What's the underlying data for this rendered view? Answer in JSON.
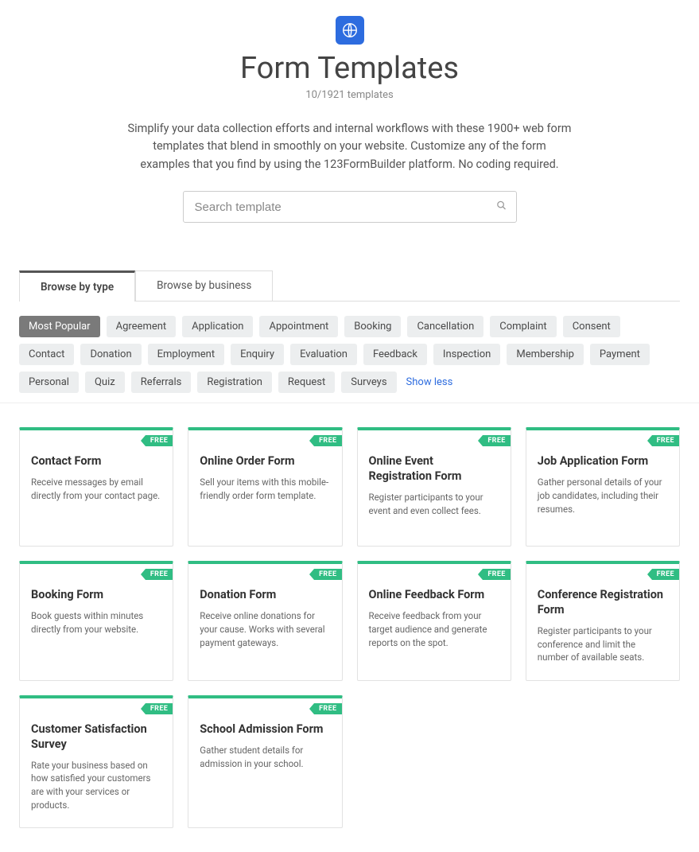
{
  "hero": {
    "title": "Form Templates",
    "count": "10/1921 templates",
    "intro": "Simplify your data collection efforts and internal workflows with these 1900+ web form templates that blend in smoothly on your website. Customize any of the form examples that you find by using the 123FormBuilder platform. No coding required."
  },
  "search": {
    "placeholder": "Search template"
  },
  "tabs": [
    {
      "label": "Browse by type"
    },
    {
      "label": "Browse by business"
    }
  ],
  "filters": [
    "Most Popular",
    "Agreement",
    "Application",
    "Appointment",
    "Booking",
    "Cancellation",
    "Complaint",
    "Consent",
    "Contact",
    "Donation",
    "Employment",
    "Enquiry",
    "Evaluation",
    "Feedback",
    "Inspection",
    "Membership",
    "Payment",
    "Personal",
    "Quiz",
    "Referrals",
    "Registration",
    "Request",
    "Surveys"
  ],
  "show_less": "Show less",
  "badge_label": "FREE",
  "cards": [
    {
      "title": "Contact Form",
      "desc": "Receive messages by email directly from your contact page."
    },
    {
      "title": "Online Order Form",
      "desc": "Sell your items with this mobile-friendly order form template."
    },
    {
      "title": "Online Event Registration Form",
      "desc": "Register participants to your event and even collect fees."
    },
    {
      "title": "Job Application Form",
      "desc": "Gather personal details of your job candidates, including their resumes."
    },
    {
      "title": "Booking Form",
      "desc": "Book guests within minutes directly from your website."
    },
    {
      "title": "Donation Form",
      "desc": "Receive online donations for your cause. Works with several payment gateways."
    },
    {
      "title": "Online Feedback Form",
      "desc": "Receive feedback from your target audience and generate reports on the spot."
    },
    {
      "title": "Conference Registration Form",
      "desc": "Register participants to your conference and limit the number of available seats."
    },
    {
      "title": "Customer Satisfaction Survey",
      "desc": "Rate your business based on how satisfied your customers are with your services or products."
    },
    {
      "title": "School Admission Form",
      "desc": "Gather student details for admission in your school."
    }
  ]
}
